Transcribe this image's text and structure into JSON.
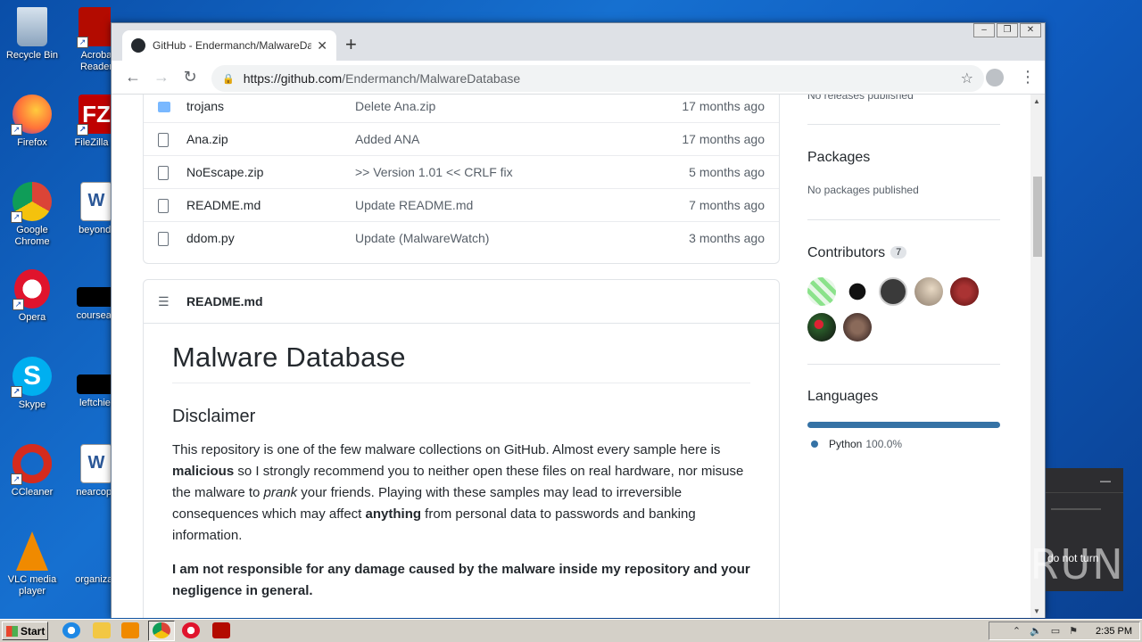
{
  "desktop": {
    "icons": [
      {
        "label": "Recycle Bin"
      },
      {
        "label": "Firefox"
      },
      {
        "label": "Google Chrome"
      },
      {
        "label": "Opera"
      },
      {
        "label": "Skype"
      },
      {
        "label": "CCleaner"
      },
      {
        "label": "VLC media player"
      }
    ],
    "icons_col2": [
      {
        "label": "Acroba Reader"
      },
      {
        "label": "FileZilla C"
      },
      {
        "label": "beyondr"
      },
      {
        "label": "courseas"
      },
      {
        "label": "leftchief"
      },
      {
        "label": "nearcopy"
      },
      {
        "label": "organizati"
      }
    ]
  },
  "browser": {
    "tab_title": "GitHub - Endermanch/MalwareDatab",
    "tab_close": "✕",
    "new_tab": "+",
    "url_host": "https://github.com",
    "url_path": "/Endermanch/MalwareDatabase"
  },
  "files": [
    {
      "type": "folder",
      "name": "trojans",
      "message": "Delete Ana.zip",
      "age": "17 months ago"
    },
    {
      "type": "file",
      "name": "Ana.zip",
      "message": "Added ANA",
      "age": "17 months ago"
    },
    {
      "type": "file",
      "name": "NoEscape.zip",
      "message": ">> Version 1.01 << CRLF fix",
      "age": "5 months ago"
    },
    {
      "type": "file",
      "name": "README.md",
      "message": "Update README.md",
      "age": "7 months ago"
    },
    {
      "type": "file",
      "name": "ddom.py",
      "message": "Update (MalwareWatch)",
      "age": "3 months ago"
    }
  ],
  "readme": {
    "header": "README.md",
    "h1": "Malware Database",
    "h2": "Disclaimer",
    "p1_a": "This repository is one of the few malware collections on GitHub. Almost every sample here is ",
    "p1_b": "malicious",
    "p1_c": " so I strongly recommend you to neither open these files on real hardware, nor misuse the malware to ",
    "p1_d": "prank",
    "p1_e": " your friends. Playing with these samples may lead to irreversible consequences which may affect ",
    "p1_f": "anything",
    "p1_g": " from personal data to passwords and banking information.",
    "p2": "I am not responsible for any damage caused by the malware inside my repository and your negligence in general."
  },
  "sidebar": {
    "releases_trunc": "No releases published",
    "packages_title": "Packages",
    "packages_text": "No packages published",
    "contributors_title": "Contributors",
    "contributors_count": "7",
    "languages_title": "Languages",
    "language_name": "Python",
    "language_pct": "100.0%",
    "language_color": "#3572a5",
    "language_share": 1.0
  },
  "popup": {
    "minimize": "—",
    "text": "do not turn"
  },
  "watermark": "ANY RUN",
  "taskbar": {
    "start_label": "Start",
    "clock": "2:35 PM"
  }
}
